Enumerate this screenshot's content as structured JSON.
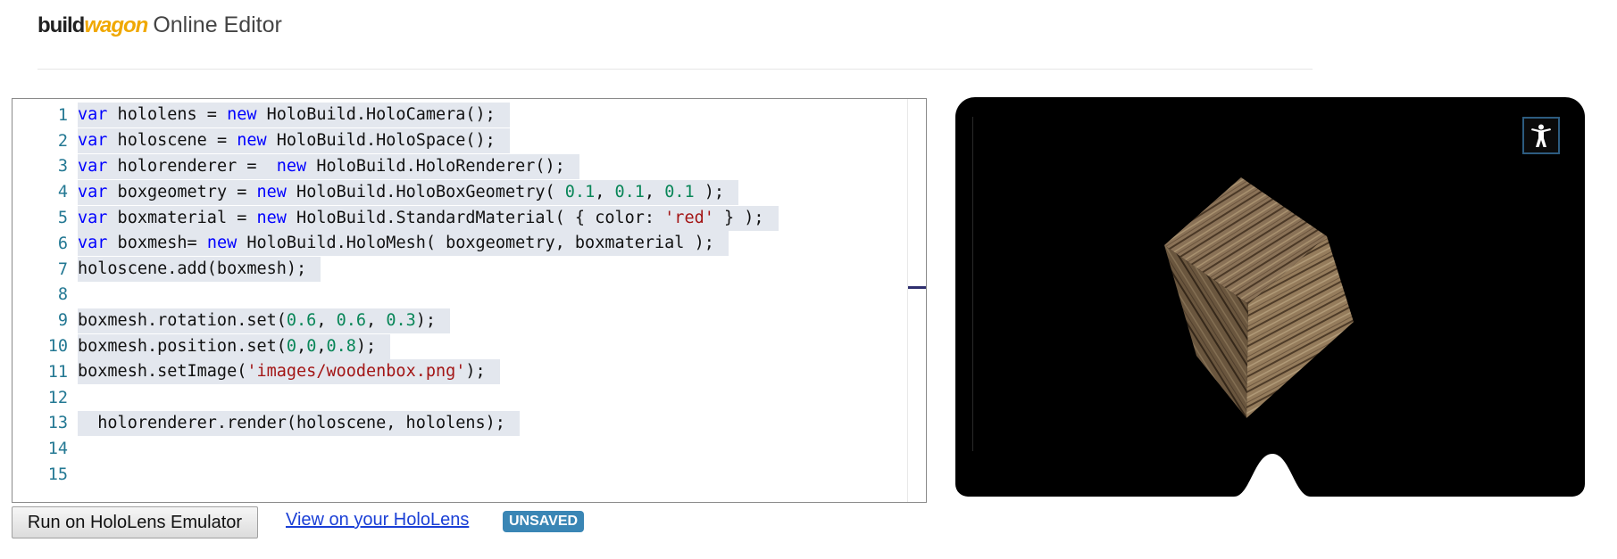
{
  "header": {
    "logo_part1": "build",
    "logo_part2": "wagon",
    "title": "Online Editor"
  },
  "editor": {
    "lines": [
      {
        "n": "1",
        "tokens": [
          [
            "kw",
            "var"
          ],
          [
            "t",
            " hololens = "
          ],
          [
            "kw",
            "new"
          ],
          [
            "t",
            " HoloBuild.HoloCamera();"
          ]
        ]
      },
      {
        "n": "2",
        "tokens": [
          [
            "kw",
            "var"
          ],
          [
            "t",
            " holoscene = "
          ],
          [
            "kw",
            "new"
          ],
          [
            "t",
            " HoloBuild.HoloSpace();"
          ]
        ]
      },
      {
        "n": "3",
        "tokens": [
          [
            "kw",
            "var"
          ],
          [
            "t",
            " holorenderer =  "
          ],
          [
            "kw",
            "new"
          ],
          [
            "t",
            " HoloBuild.HoloRenderer();"
          ]
        ]
      },
      {
        "n": "4",
        "tokens": [
          [
            "kw",
            "var"
          ],
          [
            "t",
            " boxgeometry = "
          ],
          [
            "kw",
            "new"
          ],
          [
            "t",
            " HoloBuild.HoloBoxGeometry( "
          ],
          [
            "num",
            "0.1"
          ],
          [
            "t",
            ", "
          ],
          [
            "num",
            "0.1"
          ],
          [
            "t",
            ", "
          ],
          [
            "num",
            "0.1"
          ],
          [
            "t",
            " );"
          ]
        ]
      },
      {
        "n": "5",
        "tokens": [
          [
            "kw",
            "var"
          ],
          [
            "t",
            " boxmaterial = "
          ],
          [
            "kw",
            "new"
          ],
          [
            "t",
            " HoloBuild.StandardMaterial( { color: "
          ],
          [
            "str",
            "'red'"
          ],
          [
            "t",
            " } );"
          ]
        ]
      },
      {
        "n": "6",
        "tokens": [
          [
            "kw",
            "var"
          ],
          [
            "t",
            " boxmesh= "
          ],
          [
            "kw",
            "new"
          ],
          [
            "t",
            " HoloBuild.HoloMesh( boxgeometry, boxmaterial );"
          ]
        ]
      },
      {
        "n": "7",
        "tokens": [
          [
            "t",
            "holoscene.add(boxmesh);"
          ]
        ]
      },
      {
        "n": "8",
        "tokens": [],
        "highlight": true
      },
      {
        "n": "9",
        "tokens": [
          [
            "t",
            "boxmesh.rotation.set("
          ],
          [
            "num",
            "0.6"
          ],
          [
            "t",
            ", "
          ],
          [
            "num",
            "0.6"
          ],
          [
            "t",
            ", "
          ],
          [
            "num",
            "0.3"
          ],
          [
            "t",
            ");"
          ]
        ]
      },
      {
        "n": "10",
        "tokens": [
          [
            "t",
            "boxmesh.position.set("
          ],
          [
            "num",
            "0"
          ],
          [
            "t",
            ","
          ],
          [
            "num",
            "0"
          ],
          [
            "t",
            ","
          ],
          [
            "num",
            "0.8"
          ],
          [
            "t",
            ");"
          ]
        ]
      },
      {
        "n": "11",
        "tokens": [
          [
            "t",
            "boxmesh.setImage("
          ],
          [
            "str",
            "'images/woodenbox.png'"
          ],
          [
            "t",
            ");"
          ]
        ]
      },
      {
        "n": "12",
        "tokens": [],
        "highlight": true
      },
      {
        "n": "13",
        "tokens": [
          [
            "t",
            "  holorenderer.render(holoscene, hololens);"
          ]
        ]
      },
      {
        "n": "14",
        "tokens": [],
        "highlight": true
      },
      {
        "n": "15",
        "tokens": [],
        "highlight": false
      }
    ]
  },
  "actions": {
    "run_label": "Run on HoloLens Emulator",
    "view_label": "View on your HoloLens",
    "status_badge": "UNSAVED"
  },
  "viewer": {
    "vr_icon": "cardboard-person-icon",
    "object": "wooden-box"
  },
  "colors": {
    "keyword": "#0000ff",
    "number": "#098658",
    "string": "#a31515",
    "line_number": "#237893",
    "selection": "#e3e7ee",
    "badge": "#3a86b5",
    "link": "#1a3fd6",
    "logo_accent": "#f0a800"
  }
}
